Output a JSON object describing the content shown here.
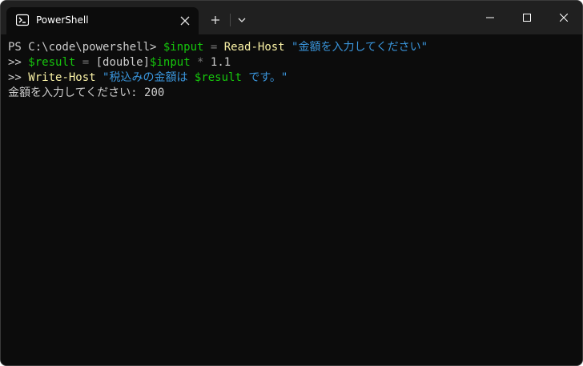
{
  "window": {
    "tab_title": "PowerShell",
    "tab_icon": "powershell-icon"
  },
  "colors": {
    "background": "#0c0c0c",
    "titlebar": "#202020",
    "variable": "#16c60c",
    "command": "#f9f1a5",
    "string": "#3a96dd",
    "default": "#cccccc",
    "operator": "#767676"
  },
  "terminal": {
    "line1": {
      "prompt": "PS C:\\code\\powershell> ",
      "var": "$input",
      "eq": " = ",
      "cmd": "Read-Host",
      "space": " ",
      "str": "\"金額を入力してください\""
    },
    "line2": {
      "prompt": ">> ",
      "var": "$result",
      "eq": " = ",
      "type": "[double]",
      "var2": "$input",
      "op": " * ",
      "num": "1.1"
    },
    "line3": {
      "prompt": ">> ",
      "cmd": "Write-Host",
      "space": " ",
      "str1": "\"税込みの金額は ",
      "var": "$result",
      "str2": " です。\""
    },
    "line4": {
      "text": "金額を入力してください: 200"
    }
  }
}
